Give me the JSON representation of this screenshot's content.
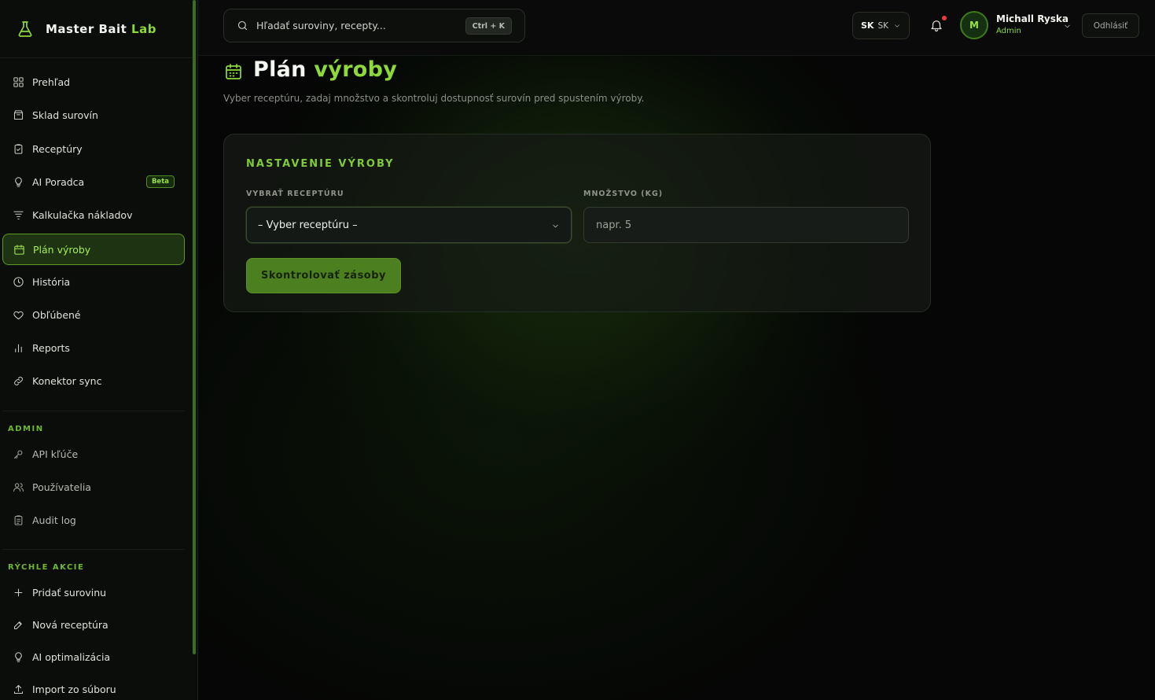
{
  "brand": {
    "name_main": "Master Bait ",
    "name_hl": "Lab"
  },
  "sidebar": {
    "items": [
      {
        "label": "Prehľad",
        "icon": "grid-icon"
      },
      {
        "label": "Sklad surovín",
        "icon": "box-icon"
      },
      {
        "label": "Receptúry",
        "icon": "clipboard-icon"
      },
      {
        "label": "AI Poradca",
        "icon": "lightbulb-icon",
        "badge": "Beta"
      },
      {
        "label": "Kalkulačka nákladov",
        "icon": "filter-icon"
      },
      {
        "label": "Plán výroby",
        "icon": "calendar-icon",
        "active": true
      },
      {
        "label": "História",
        "icon": "clock-icon"
      },
      {
        "label": "Obľúbené",
        "icon": "heart-icon"
      },
      {
        "label": "Reports",
        "icon": "bar-chart-icon"
      },
      {
        "label": "Konektor sync",
        "icon": "link-icon"
      }
    ],
    "admin_title": "ADMIN",
    "admin_items": [
      {
        "label": "API kľúče",
        "icon": "key-icon"
      },
      {
        "label": "Používatelia",
        "icon": "users-icon"
      },
      {
        "label": "Audit log",
        "icon": "clipboard-list-icon"
      }
    ],
    "quick_title": "RÝCHLE AKCIE",
    "quick_items": [
      {
        "label": "Pridať surovinu",
        "icon": "plus-icon"
      },
      {
        "label": "Nová receptúra",
        "icon": "edit-icon"
      },
      {
        "label": "AI optimalizácia",
        "icon": "lightbulb-icon"
      },
      {
        "label": "Import zo súboru",
        "icon": "upload-icon"
      }
    ]
  },
  "header": {
    "search_placeholder": "Hľadať suroviny, recepty...",
    "search_shortcut": "Ctrl + K",
    "lang_code": "SK",
    "lang_label": "SK",
    "user_initial": "M",
    "user_name": "Michall Ryska",
    "user_role": "Admin",
    "logout_label": "Odhlásiť"
  },
  "main": {
    "title_main": "Plán ",
    "title_hl": "výroby",
    "subtitle": "Vyber receptúru, zadaj množstvo a skontroluj dostupnosť surovín pred spustením výroby.",
    "card": {
      "title": "NASTAVENIE VÝROBY",
      "recipe_label": "VYBRAŤ RECEPTÚRU",
      "recipe_value": "– Vyber receptúru –",
      "qty_label": "MNOŽSTVO (KG)",
      "qty_placeholder": "napr. 5",
      "button": "Skontrolovať zásoby"
    }
  },
  "colors": {
    "accent": "#8ed83a",
    "active_bg": "#1d3311",
    "background": "#070807"
  }
}
